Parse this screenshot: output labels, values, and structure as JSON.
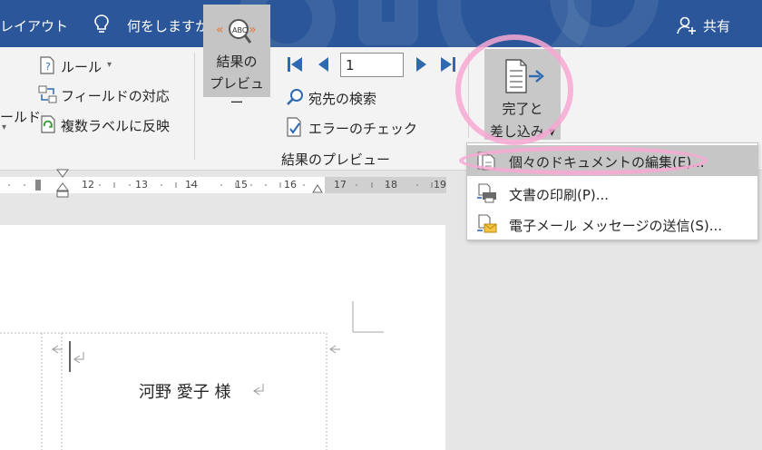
{
  "titlebar": {
    "tab_layout": "レイアウト",
    "tellme": "何をしますか",
    "share": "共有",
    "icons": [
      "lightbulb-icon",
      "person-add-icon"
    ],
    "bg_color": "#2b579a"
  },
  "ribbon": {
    "rules_label": "ルール",
    "rules_arrow": "▾",
    "match_fields_label": "フィールドの対応",
    "update_labels_label": "複数ラベルに反映",
    "left_cut_label_1": "ールド",
    "left_cut_label_2": "▾",
    "preview_label_1": "結果の",
    "preview_label_2": "プレビュー",
    "record_value": "1",
    "find_recipient_label": "宛先の検索",
    "check_errors_label": "エラーのチェック",
    "group_preview_label": "結果のプレビュー",
    "finish_label_1": "完了と",
    "finish_label_2": "差し込み ▾",
    "icons": [
      "rules-icon",
      "match-fields-icon",
      "update-labels-icon",
      "preview-results-icon",
      "first-record-icon",
      "prev-record-icon",
      "next-record-icon",
      "last-record-icon",
      "find-recipient-icon",
      "check-errors-icon",
      "finish-merge-icon"
    ]
  },
  "ruler": {
    "ticks": [
      "12",
      "13",
      "14",
      "15",
      "16",
      "17",
      "18",
      "19"
    ]
  },
  "dropdown": {
    "items": [
      {
        "label": "個々のドキュメントの編集(E)...",
        "icon": "edit-documents-icon"
      },
      {
        "label": "文書の印刷(P)...",
        "icon": "print-documents-icon"
      },
      {
        "label": "電子メール メッセージの送信(S)...",
        "icon": "send-email-icon"
      }
    ]
  },
  "document": {
    "label_text": "河野 愛子 様"
  },
  "colors": {
    "annotation_pink": "#f7a8d2",
    "hover_gray": "#c6c6c6",
    "ribbon_bg": "#f3f3f3",
    "accent_blue": "#2b579a",
    "nav_blue": "#2f6ab0"
  }
}
